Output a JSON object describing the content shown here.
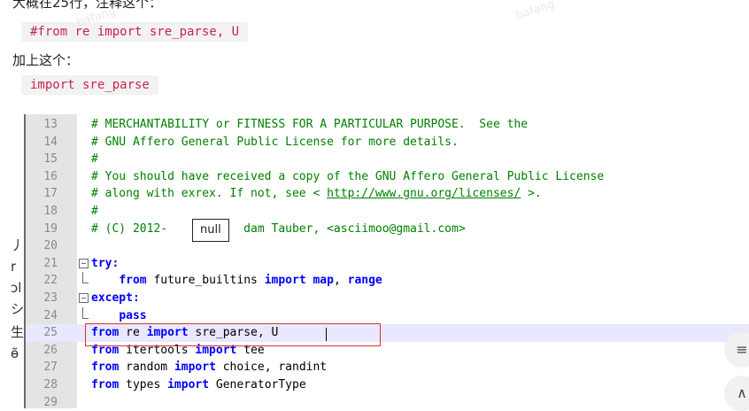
{
  "article": {
    "line1": "大概在25行，注释这个：",
    "chip1": "#from re import sre_parse, U",
    "line2": "加上这个：",
    "chip2": "import sre_parse",
    "side_chars": [
      "丿",
      "r",
      "ɔl",
      "シ",
      "生",
      "ɵ̃"
    ]
  },
  "watermarks": [
    "bafang",
    "bafang"
  ],
  "editor": {
    "lines": [
      {
        "num": "13",
        "tokens": [
          {
            "c": "cm",
            "t": "# MERCHANTABILITY or FITNESS FOR A PARTICULAR PURPOSE.  See the"
          }
        ]
      },
      {
        "num": "14",
        "tokens": [
          {
            "c": "cm",
            "t": "# GNU Affero General Public License for more details."
          }
        ]
      },
      {
        "num": "15",
        "tokens": [
          {
            "c": "cm",
            "t": "#"
          }
        ]
      },
      {
        "num": "16",
        "tokens": [
          {
            "c": "cm",
            "t": "# You should have received a copy of the GNU Affero General Public License"
          }
        ]
      },
      {
        "num": "17",
        "tokens": [
          {
            "c": "cm",
            "t": "# along with exrex. If not, see < "
          },
          {
            "c": "url",
            "t": "http://www.gnu.org/licenses/"
          },
          {
            "c": "cm",
            "t": " >."
          }
        ]
      },
      {
        "num": "18",
        "tokens": [
          {
            "c": "cm",
            "t": "#"
          }
        ]
      },
      {
        "num": "19",
        "tokens": [
          {
            "c": "cm",
            "t": "# (C) 2012-           dam Tauber, <asciimoo@gmail.com>"
          }
        ]
      },
      {
        "num": "20",
        "tokens": []
      },
      {
        "num": "21",
        "tokens": [
          {
            "c": "kw",
            "t": "try:"
          }
        ],
        "fold": "open"
      },
      {
        "num": "22",
        "tokens": [
          {
            "c": "plain",
            "t": "    "
          },
          {
            "c": "kw",
            "t": "from"
          },
          {
            "c": "plain",
            "t": " future_builtins "
          },
          {
            "c": "kw",
            "t": "import"
          },
          {
            "c": "plain",
            "t": " "
          },
          {
            "c": "kw",
            "t": "map"
          },
          {
            "c": "plain",
            "t": ", "
          },
          {
            "c": "kw",
            "t": "range"
          }
        ],
        "fold": "end"
      },
      {
        "num": "23",
        "tokens": [
          {
            "c": "kw",
            "t": "except:"
          }
        ],
        "fold": "open"
      },
      {
        "num": "24",
        "tokens": [
          {
            "c": "plain",
            "t": "    "
          },
          {
            "c": "kw",
            "t": "pass"
          }
        ],
        "fold": "end"
      },
      {
        "num": "25",
        "tokens": [
          {
            "c": "kw",
            "t": "from"
          },
          {
            "c": "plain",
            "t": " re "
          },
          {
            "c": "kw",
            "t": "import"
          },
          {
            "c": "plain",
            "t": " sre_parse, U"
          }
        ],
        "current": true
      },
      {
        "num": "26",
        "tokens": [
          {
            "c": "kw",
            "t": "from"
          },
          {
            "c": "plain",
            "t": " itertools "
          },
          {
            "c": "kw",
            "t": "import"
          },
          {
            "c": "plain",
            "t": " tee"
          }
        ]
      },
      {
        "num": "27",
        "tokens": [
          {
            "c": "kw",
            "t": "from"
          },
          {
            "c": "plain",
            "t": " random "
          },
          {
            "c": "kw",
            "t": "import"
          },
          {
            "c": "plain",
            "t": " choice, randint"
          }
        ]
      },
      {
        "num": "28",
        "tokens": [
          {
            "c": "kw",
            "t": "from"
          },
          {
            "c": "plain",
            "t": " types "
          },
          {
            "c": "kw",
            "t": "import"
          },
          {
            "c": "plain",
            "t": " GeneratorType"
          }
        ]
      },
      {
        "num": "29",
        "tokens": []
      }
    ],
    "null_tooltip": "null"
  },
  "float_buttons": {
    "menu_glyph": "≡",
    "up_glyph": "∧"
  }
}
